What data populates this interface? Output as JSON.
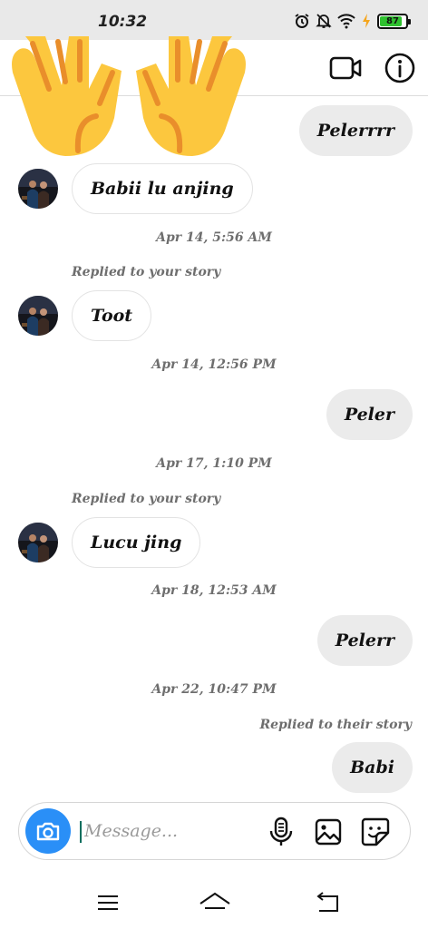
{
  "status_bar": {
    "time": "10:32",
    "battery": "87"
  },
  "header": {
    "back_icon": "arrow-left-icon",
    "video_icon": "video-camera-icon",
    "info_icon": "info-icon"
  },
  "chat": {
    "messages": [
      {
        "type": "sent",
        "text": "Pelerrrr"
      },
      {
        "type": "received",
        "text": "Babii lu anjing"
      },
      {
        "type": "timestamp",
        "text": "Apr 14, 5:56 AM"
      },
      {
        "type": "reply_note",
        "text": "Replied to your story"
      },
      {
        "type": "received",
        "text": "Toot"
      },
      {
        "type": "timestamp",
        "text": "Apr 14, 12:56 PM"
      },
      {
        "type": "sent",
        "text": "Peler"
      },
      {
        "type": "timestamp",
        "text": "Apr 17, 1:10 PM"
      },
      {
        "type": "reply_note",
        "text": "Replied to your story"
      },
      {
        "type": "received",
        "text": "Lucu jing"
      },
      {
        "type": "timestamp",
        "text": "Apr 18, 12:53 AM"
      },
      {
        "type": "sent",
        "text": "Pelerr"
      },
      {
        "type": "timestamp",
        "text": "Apr 22, 10:47 PM"
      },
      {
        "type": "reply_note",
        "text": "Replied to their story"
      },
      {
        "type": "sent",
        "text": "Babi"
      }
    ]
  },
  "composer": {
    "placeholder": "Message...",
    "icons": [
      "camera-icon",
      "microphone-icon",
      "gallery-icon",
      "sticker-icon"
    ]
  },
  "nav_bar": {
    "icons": [
      "menu-icon",
      "home-icon",
      "back-icon"
    ]
  },
  "colors": {
    "accent": "#2a8ff7",
    "sent_bubble": "#ebebeb",
    "timestamp": "#6e6e6e",
    "emoji": "#fcc73e"
  }
}
